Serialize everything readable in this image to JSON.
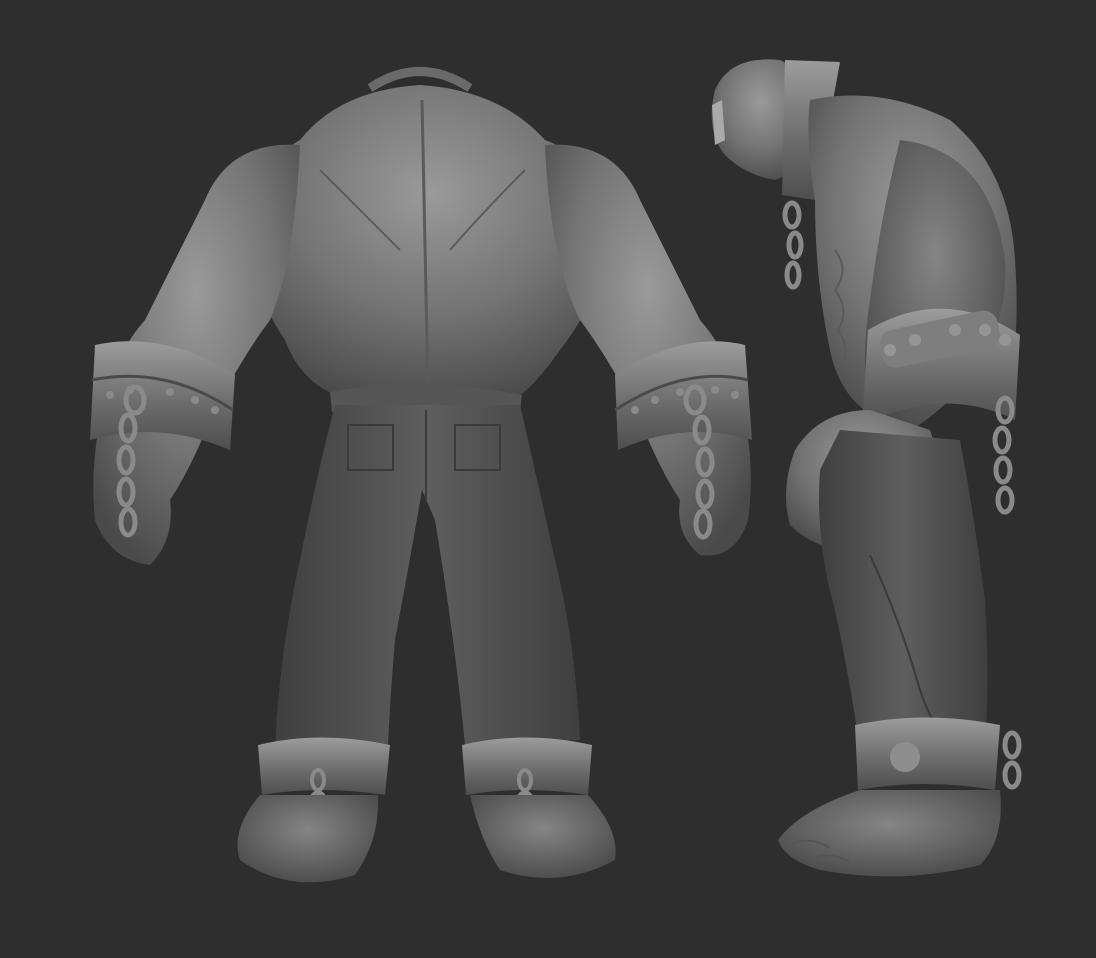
{
  "scene": {
    "background_color": "#2e2e2e",
    "material_color": "#7a7a7a",
    "views": [
      {
        "name": "back-view"
      },
      {
        "name": "side-view"
      }
    ]
  }
}
